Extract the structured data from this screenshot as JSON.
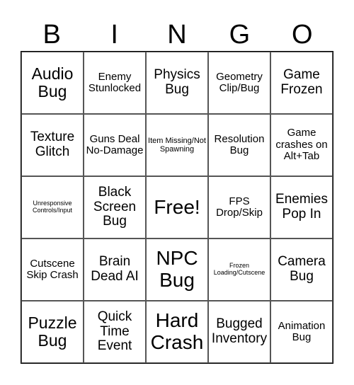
{
  "header": [
    "B",
    "I",
    "N",
    "G",
    "O"
  ],
  "cells": [
    [
      "Audio Bug",
      "Enemy Stunlocked",
      "Physics Bug",
      "Geometry Clip/Bug",
      "Game Frozen"
    ],
    [
      "Texture Glitch",
      "Guns Deal No-Damage",
      "Item Missing/Not Spawning",
      "Resolution Bug",
      "Game crashes on Alt+Tab"
    ],
    [
      "Unresponsive Controls/Input",
      "Black Screen Bug",
      "Free!",
      "FPS Drop/Skip",
      "Enemies Pop In"
    ],
    [
      "Cutscene Skip Crash",
      "Brain Dead AI",
      "NPC Bug",
      "Frozen Loading/Cutscene",
      "Camera Bug"
    ],
    [
      "Puzzle Bug",
      "Quick Time Event",
      "Hard Crash",
      "Bugged Inventory",
      "Animation Bug"
    ]
  ]
}
